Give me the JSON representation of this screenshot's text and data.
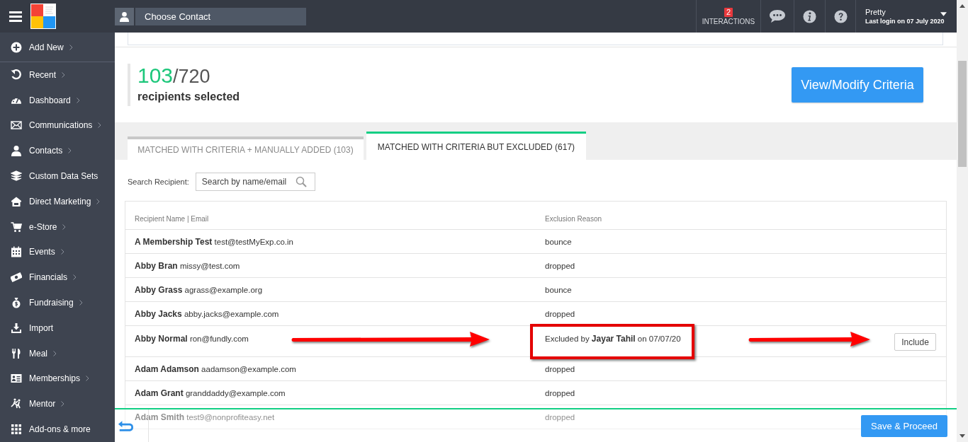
{
  "topbar": {
    "contact": {
      "placeholder": "Choose Contact"
    },
    "interactions": {
      "count": "2",
      "label": "INTERACTIONS"
    },
    "user": {
      "name": "Pretty",
      "last_login": "Last login on 07 July 2020"
    }
  },
  "sidebar": {
    "items": [
      {
        "label": "Add New",
        "submenu": true
      },
      {
        "label": "Recent",
        "submenu": true
      },
      {
        "label": "Dashboard",
        "submenu": true
      },
      {
        "label": "Communications",
        "submenu": true
      },
      {
        "label": "Contacts",
        "submenu": true
      },
      {
        "label": "Custom Data Sets",
        "submenu": false
      },
      {
        "label": "Direct Marketing",
        "submenu": true
      },
      {
        "label": "e-Store",
        "submenu": true
      },
      {
        "label": "Events",
        "submenu": true
      },
      {
        "label": "Financials",
        "submenu": true
      },
      {
        "label": "Fundraising",
        "submenu": true
      },
      {
        "label": "Import",
        "submenu": false
      },
      {
        "label": "Meal",
        "submenu": true
      },
      {
        "label": "Memberships",
        "submenu": true
      },
      {
        "label": "Mentor",
        "submenu": true
      },
      {
        "label": "Add-ons & more",
        "submenu": false
      }
    ]
  },
  "summary": {
    "selected": "103",
    "total": "/720",
    "caption": "recipients selected",
    "button": "View/Modify Criteria"
  },
  "tabs": [
    {
      "label": "MATCHED WITH CRITERIA + MANUALLY ADDED (103)",
      "selected": false
    },
    {
      "label": "MATCHED WITH CRITERIA BUT EXCLUDED (617)",
      "selected": true
    }
  ],
  "search": {
    "label": "Search Recipient:",
    "placeholder": "Search by name/email"
  },
  "table": {
    "columns": [
      "Recipient Name | Email",
      "Exclusion Reason"
    ],
    "rows": [
      {
        "name": "A Membership Test",
        "email": "test@testMyExp.co.in",
        "reason": "bounce"
      },
      {
        "name": "Abby Bran",
        "email": "missy@test.com",
        "reason": "dropped"
      },
      {
        "name": "Abby Grass",
        "email": "agrass@example.org",
        "reason": "bounce"
      },
      {
        "name": "Abby Jacks",
        "email": "abby.jacks@example.com",
        "reason": "dropped"
      },
      {
        "name": "Abby Normal",
        "email": "ron@fundly.com",
        "reason": "Excluded by **Jayar Tahil** on 07/07/20",
        "action": "Include",
        "annotated": true
      },
      {
        "name": "Adam Adamson",
        "email": "aadamson@example.com",
        "reason": "dropped"
      },
      {
        "name": "Adam Grant",
        "email": "granddaddy@example.com",
        "reason": "dropped"
      },
      {
        "name": "Adam Smith",
        "email": "test9@nonprofiteasy.net",
        "reason": "dropped"
      }
    ]
  },
  "footer": {
    "button": "Save & Proceed"
  }
}
